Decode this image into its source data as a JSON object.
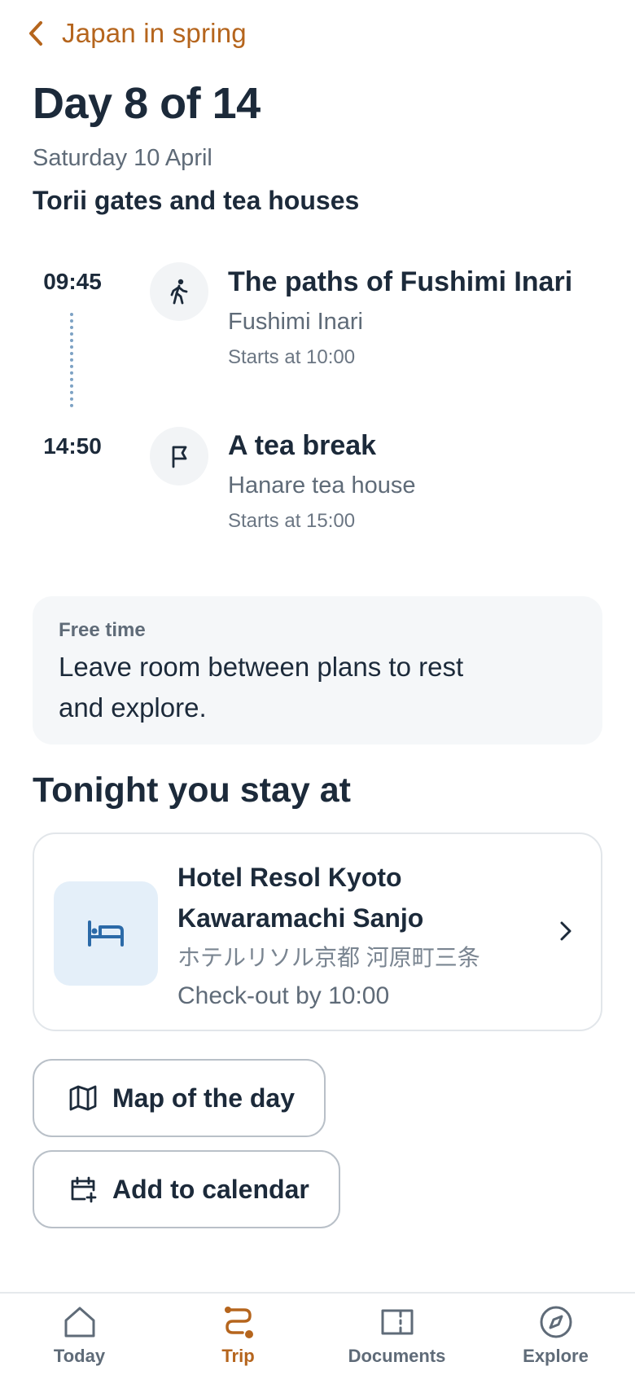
{
  "colors": {
    "accent": "#b5651d",
    "text": "#1c2a3a",
    "muted": "#5f6b78",
    "highlight": "#f5c52c",
    "card_bg": "#f5f7f9",
    "hotel_thumb_bg": "#e4eff9"
  },
  "nav": {
    "back_label": "Japan in spring",
    "back_icon": "chevron-left-icon"
  },
  "day": {
    "title": "Day 8 of 14",
    "date": "Saturday 10 April",
    "theme": "Torii gates and tea houses"
  },
  "timeline": [
    {
      "time": "09:45",
      "current": true,
      "icon": "walking-icon",
      "title": "The paths of Fushimi Inari",
      "place": "Fushimi Inari",
      "starts": "Starts at 10:00"
    },
    {
      "time": "14:50",
      "current": false,
      "icon": "flag-icon",
      "title": "A tea break",
      "place": "Hanare tea house",
      "starts": "Starts at 15:00"
    }
  ],
  "free_time": {
    "label": "Free time",
    "text": "Leave room between plans to rest and explore."
  },
  "stay": {
    "heading": "Tonight you stay at",
    "hotel_name": "Hotel Resol Kyoto Kawaramachi Sanjo",
    "hotel_local_name": "ホテルリソル京都 河原町三条",
    "checkout": "Check-out by 10:00",
    "icon": "bed-icon"
  },
  "actions": {
    "map_label": "Map of the day",
    "calendar_label": "Add to calendar"
  },
  "tabs": [
    {
      "label": "Today",
      "icon": "home-icon",
      "active": false
    },
    {
      "label": "Trip",
      "icon": "route-icon",
      "active": true
    },
    {
      "label": "Documents",
      "icon": "ticket-icon",
      "active": false
    },
    {
      "label": "Explore",
      "icon": "compass-icon",
      "active": false
    }
  ]
}
